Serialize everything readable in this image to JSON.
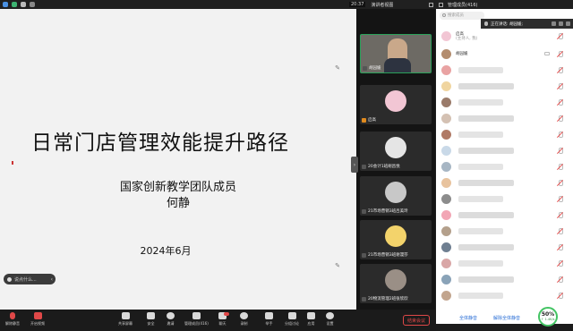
{
  "topbar": {
    "time": "20:37",
    "view_label": "演讲者视图",
    "manage_label": "管理成员(416)"
  },
  "slide": {
    "title": "日常门店管理效能提升路径",
    "subtitle_line1": "国家创新教学团队成员",
    "subtitle_line2": "何静",
    "date": "2024年6月",
    "chat_placeholder": "说点什么..."
  },
  "video_tiles": [
    {
      "name": "胡园媛",
      "avatar_color": "#c9b48e",
      "active": true,
      "host": false
    },
    {
      "name": "启高",
      "avatar_color": "#f2c6d4",
      "active": false,
      "host": true
    },
    {
      "name": "20会计1班胡昌悦",
      "avatar_color": "#e5e5e5",
      "active": false,
      "host": false
    },
    {
      "name": "21市场营销3班吕美玲",
      "avatar_color": "#c8c8c8",
      "active": false,
      "host": false
    },
    {
      "name": "21市场营销3班谢漫莎",
      "avatar_color": "#f3d36b",
      "active": false,
      "host": false
    },
    {
      "name": "20物流管理2班张欣欣",
      "avatar_color": "#9a8f86",
      "active": false,
      "host": false
    }
  ],
  "panel": {
    "search_placeholder": "搜索成员",
    "speaking_label": "正在讲话: 胡园媛;",
    "host_name": "启高",
    "host_role": "(主持人, 我)",
    "cohost_name": "胡园媛",
    "mute_all": "全体静音",
    "unmute_all": "解除全体静音"
  },
  "participants_colors": [
    "#f4c6c6",
    "#f0d5a0",
    "#e9a3a3",
    "#9a7b6a",
    "#d4c1b3",
    "#b07a66",
    "#c9d9e8",
    "#a7b6c4",
    "#e8c39e",
    "#8c8c8c",
    "#f2a6b5",
    "#b4a08c",
    "#6f7f91",
    "#d9a7a7",
    "#8aa3b8",
    "#c2a58e",
    "#e6b3a3",
    "#9fb2a1",
    "#b99b8a",
    "#d4a5c0",
    "#a49c95"
  ],
  "toolbar": {
    "mute_label": "解除静音",
    "video_label": "开启视频",
    "share_label": "共享屏幕",
    "security_label": "安全",
    "invite_label": "邀请",
    "members_label": "管理成员(416)",
    "chat_label": "聊天",
    "record_label": "录制",
    "raise_label": "举手",
    "breakout_label": "分组讨论",
    "apps_label": "应用",
    "settings_label": "设置",
    "end_label": "结束会议",
    "chat_badge": "18"
  },
  "network": {
    "percent": "50%",
    "speed": "↑ 1.4K/s"
  }
}
